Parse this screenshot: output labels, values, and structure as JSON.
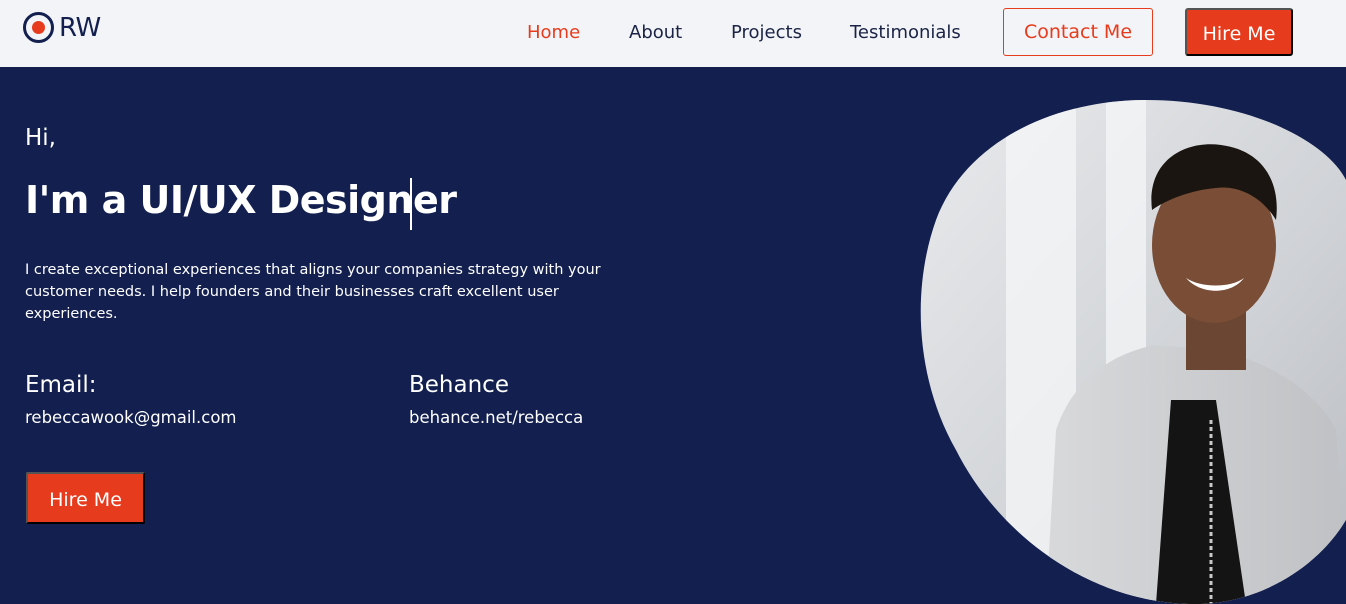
{
  "brand": {
    "name": "RW"
  },
  "nav": {
    "items": [
      {
        "label": "Home"
      },
      {
        "label": "About"
      },
      {
        "label": "Projects"
      },
      {
        "label": "Testimonials"
      }
    ],
    "contact_label": "Contact Me",
    "hire_label": "Hire Me"
  },
  "hero": {
    "greeting": "Hi,",
    "title": "I'm a UI/UX Designer",
    "description": "I create exceptional experiences that aligns your companies strategy with your customer needs. I help founders and their businesses craft excellent user experiences.",
    "email_label": "Email:",
    "email_value": "rebeccawook@gmail.com",
    "behance_label": "Behance",
    "behance_value": "behance.net/rebecca",
    "hire_label": "Hire Me"
  },
  "colors": {
    "navy": "#121f4f",
    "accent": "#e63b1c",
    "topbar": "#f3f4f7"
  },
  "icons": {
    "logo": "target-ring-icon"
  }
}
